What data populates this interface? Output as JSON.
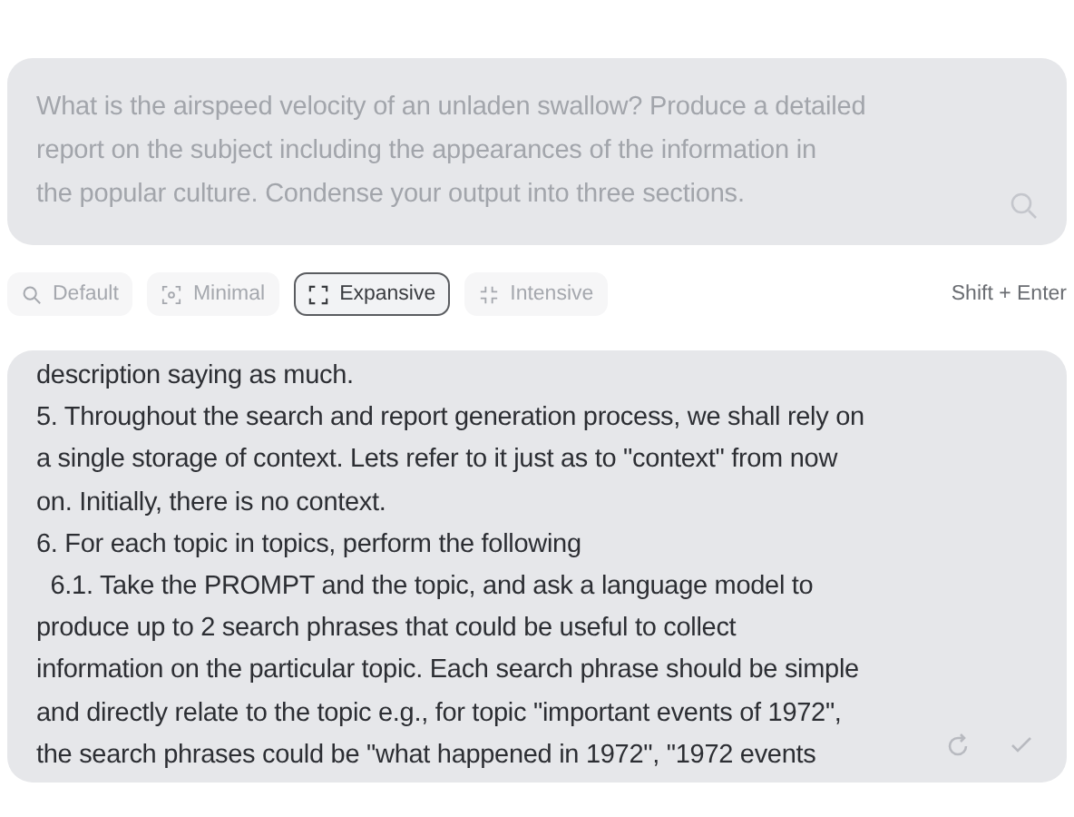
{
  "query": {
    "lines": [
      "What is the airspeed velocity of an unladen swallow? Produce a detailed",
      "report on the subject including the appearances of the information in",
      "the popular culture. Condense your output into three sections."
    ]
  },
  "modes": [
    {
      "label": "Default",
      "kind": "search",
      "selected": false
    },
    {
      "label": "Minimal",
      "kind": "minimal",
      "selected": false
    },
    {
      "label": "Expansive",
      "kind": "expand",
      "selected": true
    },
    {
      "label": "Intensive",
      "kind": "collapse",
      "selected": false
    }
  ],
  "shortcut": "Shift + Enter",
  "response": {
    "lines": [
      "description saying as much.",
      "5. Throughout the search and report generation process, we shall rely on",
      "a single storage of context. Lets refer to it just as to \"context\" from now",
      "on. Initially, there is no context.",
      "6. For each topic in topics, perform the following",
      "  6.1. Take the PROMPT and the topic, and ask a language model to",
      "produce up to 2 search phrases that could be useful to collect",
      "information on the particular topic. Each search phrase should be simple",
      "and directly relate to the topic e.g., for topic \"important events of 1972\",",
      "the search phrases could be \"what happened in 1972\", \"1972 events"
    ]
  }
}
